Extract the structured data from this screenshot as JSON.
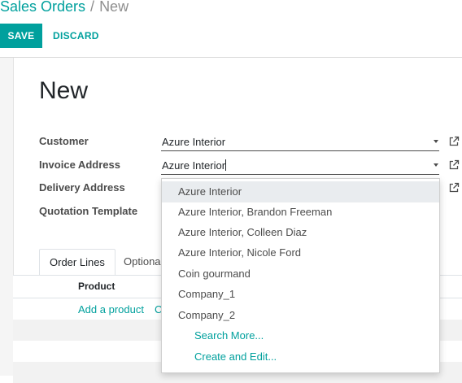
{
  "breadcrumb": {
    "parent": "Sales Orders",
    "separator": "/",
    "current": "New"
  },
  "buttons": {
    "save": "SAVE",
    "discard": "DISCARD"
  },
  "record": {
    "title": "New"
  },
  "fields": {
    "customer": {
      "label": "Customer",
      "value": "Azure Interior"
    },
    "invoice_address": {
      "label": "Invoice Address",
      "value": "Azure Interior"
    },
    "delivery_address": {
      "label": "Delivery Address"
    },
    "quotation_template": {
      "label": "Quotation Template"
    }
  },
  "tabs": [
    {
      "label": "Order Lines"
    },
    {
      "label": "Optional"
    }
  ],
  "order_lines": {
    "column_product": "Product",
    "add_product": "Add a product",
    "add_other": "C"
  },
  "dropdown": {
    "items": [
      "Azure Interior",
      "Azure Interior, Brandon Freeman",
      "Azure Interior, Colleen Diaz",
      "Azure Interior, Nicole Ford",
      "Coin gourmand",
      "Company_1",
      "Company_2"
    ],
    "search_more": "Search More...",
    "create_and_edit": "Create and Edit..."
  },
  "colors": {
    "accent": "#00a09d",
    "text": "#4c4c4c",
    "highlight": "#e9ecef"
  },
  "icons": {
    "external": "external-link-icon",
    "caret": "caret-down-icon"
  }
}
